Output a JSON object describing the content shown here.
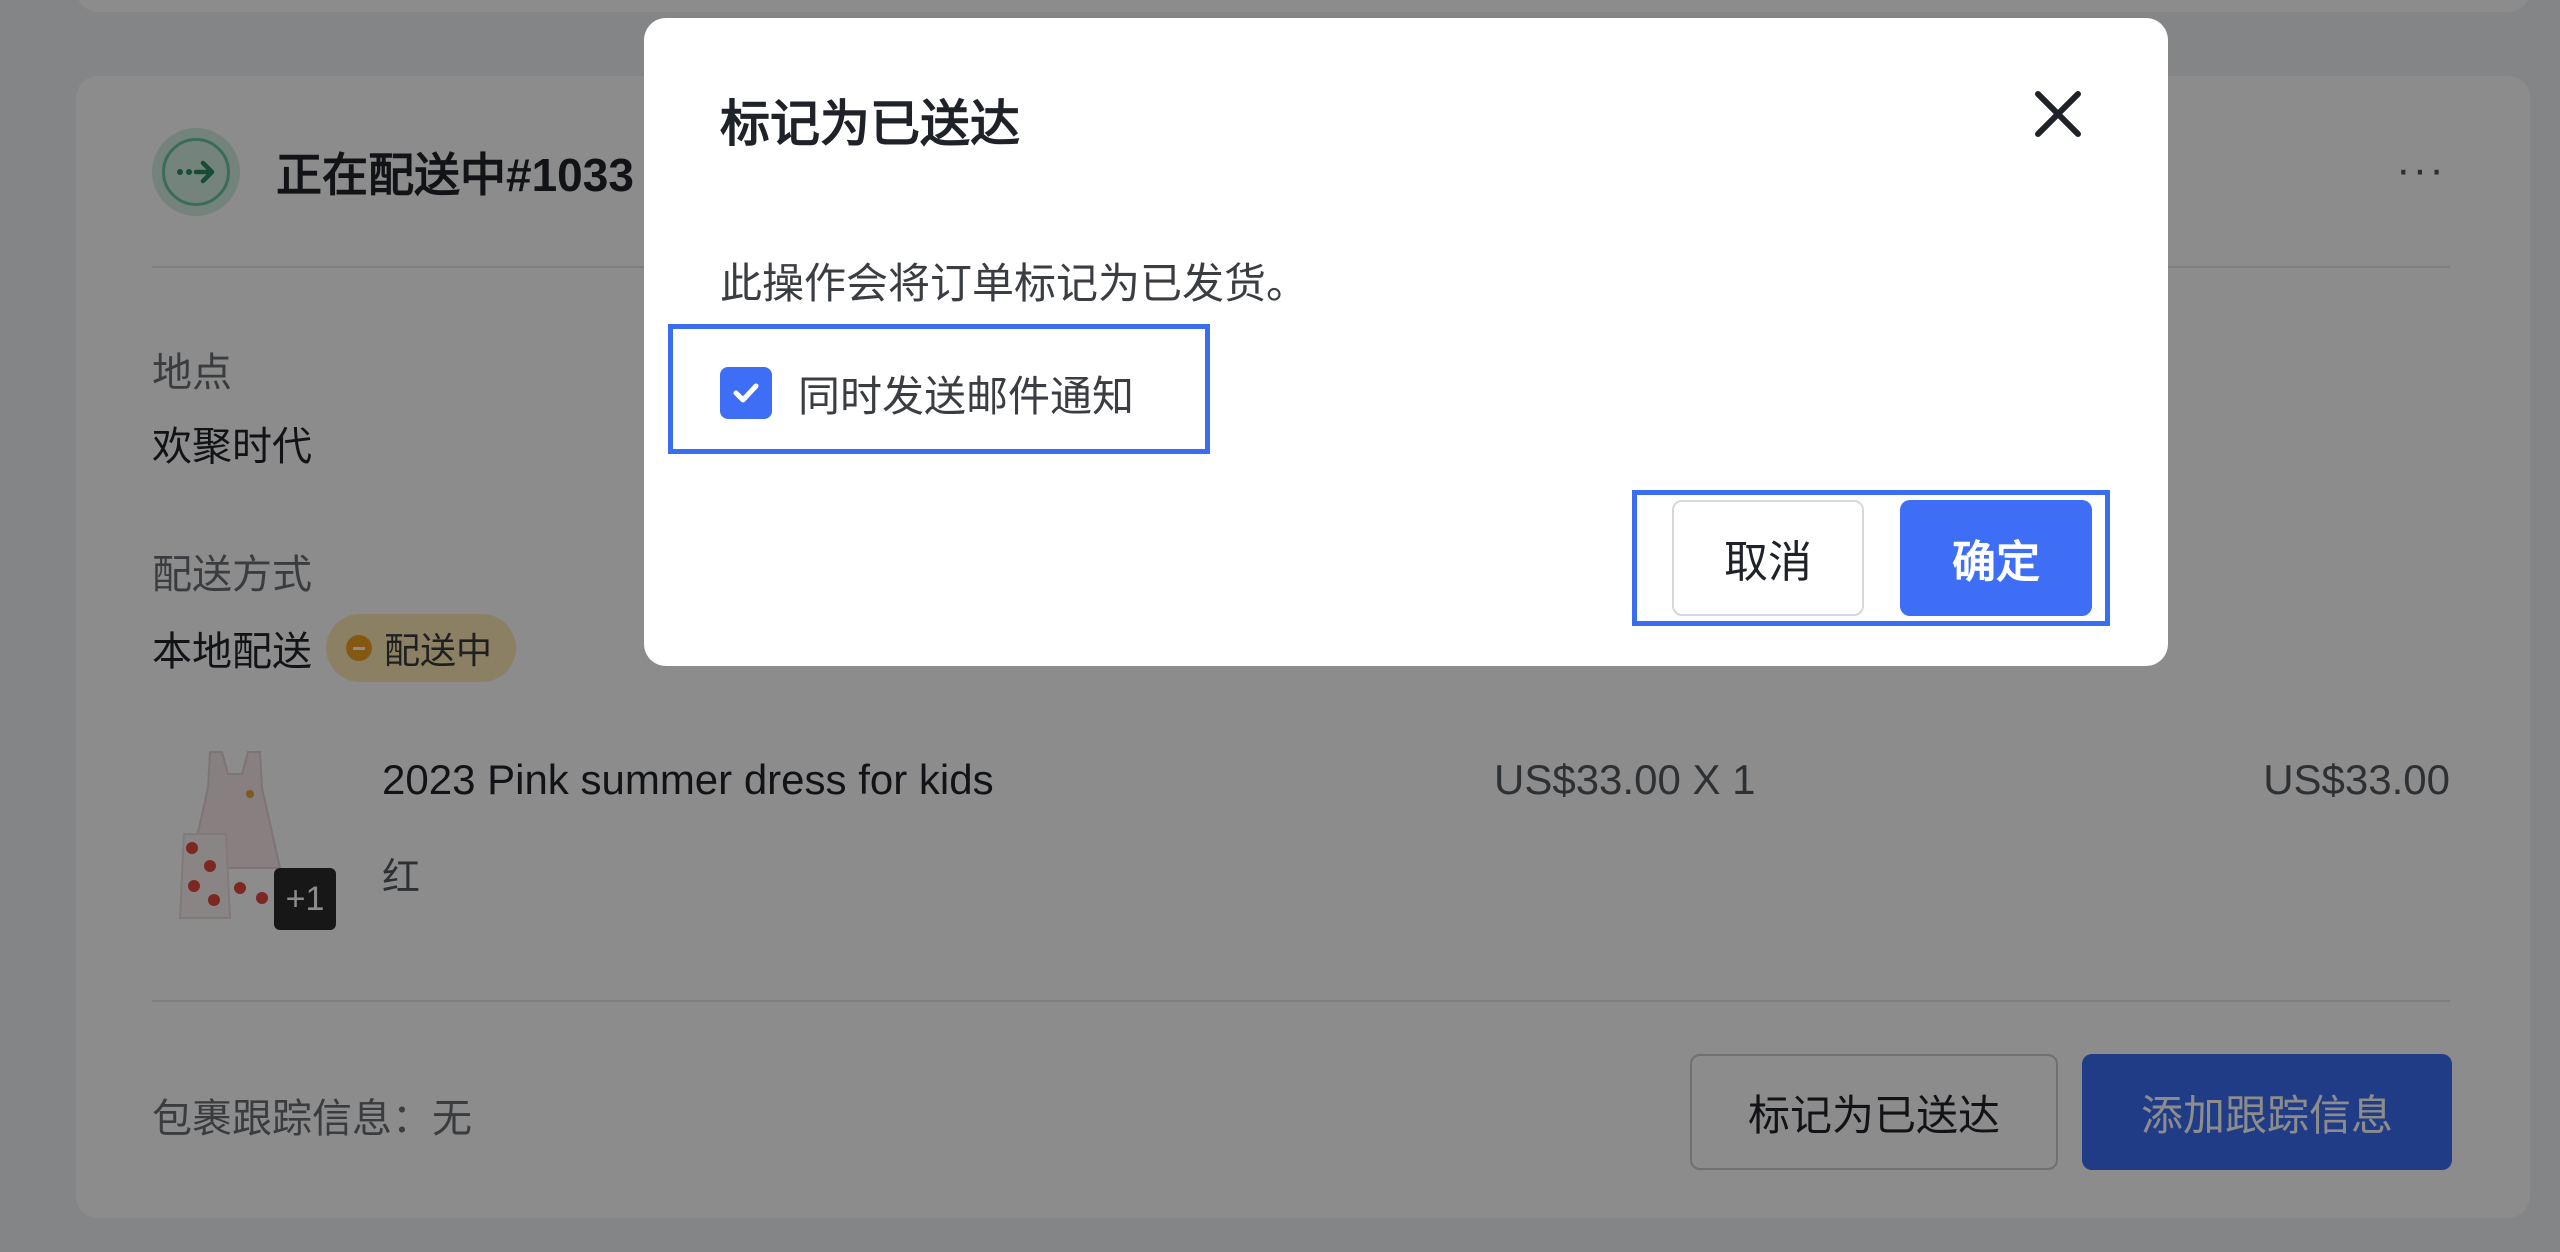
{
  "background": {
    "card_title": "正在配送中#1033",
    "location": {
      "label": "地点",
      "value": "欢聚时代"
    },
    "shipping": {
      "label": "配送方式",
      "value": "本地配送",
      "badge": "配送中"
    },
    "product": {
      "name": "2023 Pink summer dress for kids",
      "variant": "红",
      "unit_price": "US$33.00 X 1",
      "total": "US$33.00",
      "extra_count": "+1"
    },
    "tracking": "包裹跟踪信息：无",
    "mark_delivered_button": "标记为已送达",
    "add_tracking_button": "添加跟踪信息"
  },
  "modal": {
    "title": "标记为已送达",
    "description": "此操作会将订单标记为已发货。",
    "checkbox_label": "同时发送邮件通知",
    "checkbox_checked": true,
    "cancel": "取消",
    "confirm": "确定"
  },
  "colors": {
    "primary": "#3d6ef5",
    "status_badge": "#fdeab6",
    "highlight": "#3b6df0"
  }
}
